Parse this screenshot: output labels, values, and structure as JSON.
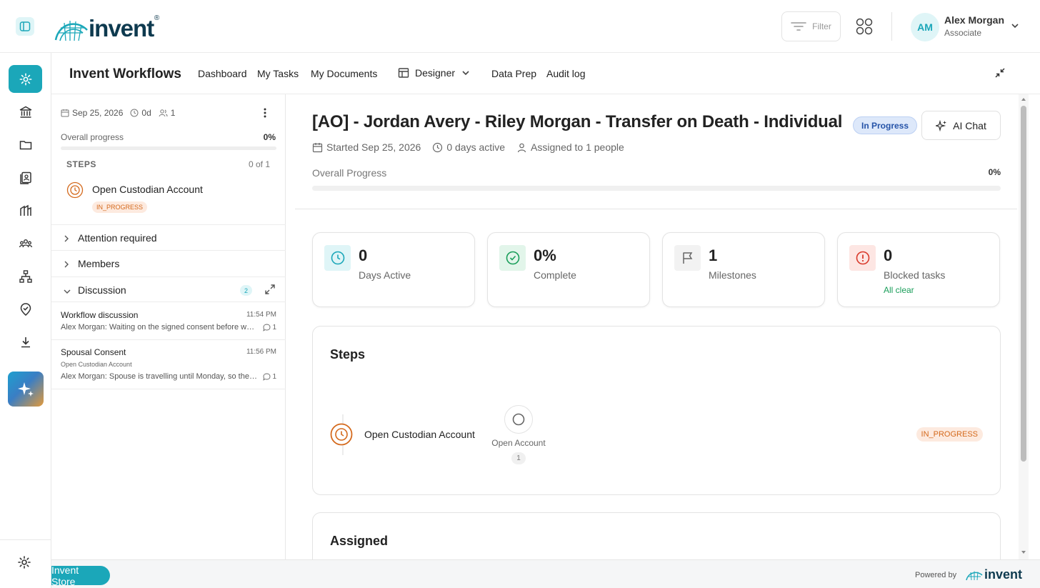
{
  "app": {
    "logo_text": "invent",
    "logo_reg": "®",
    "filter_label": "Filter",
    "user": {
      "initials": "AM",
      "name": "Alex Morgan",
      "role": "Associate"
    }
  },
  "rail": {
    "icons": [
      "gear-icon",
      "bank-icon",
      "folder-icon",
      "contacts-icon",
      "vault-icon",
      "team-icon",
      "org-chart-icon",
      "verified-icon",
      "download-icon"
    ],
    "ai_icon": "sparkle-icon",
    "bottom_icon": "settings-icon"
  },
  "workflow_bar": {
    "title": "Invent Workflows",
    "nav": [
      "Dashboard",
      "My Tasks",
      "My Documents"
    ],
    "designer": "Designer",
    "nav2": [
      "Data Prep",
      "Audit log"
    ]
  },
  "left_panel": {
    "date": "Sep 25, 2026",
    "days": "0d",
    "people": "1",
    "progress_label": "Overall progress",
    "progress_value": "0%",
    "progress_fraction": 0,
    "steps_heading": "STEPS",
    "steps_count": "0 of 1",
    "step": {
      "name": "Open Custodian Account",
      "status": "IN_PROGRESS"
    },
    "sections": {
      "attention": "Attention required",
      "members": "Members",
      "discussion": "Discussion",
      "discussion_count": "2"
    },
    "discussions": [
      {
        "title": "Workflow discussion",
        "time": "11:54 PM",
        "subtitle": "",
        "message": "Alex Morgan: Waiting on the signed consent before we ...",
        "replies": "1"
      },
      {
        "title": "Spousal Consent",
        "time": "11:56 PM",
        "subtitle": "Open Custodian Account",
        "message": "Alex Morgan: Spouse is travelling until Monday, so the ...",
        "replies": "1"
      }
    ]
  },
  "main": {
    "title": "[AO] - Jordan Avery - Riley Morgan - Transfer on Death - Individual",
    "status": "In Progress",
    "ai_chat": "AI Chat",
    "started": "Started Sep 25, 2026",
    "active": "0 days active",
    "assigned": "Assigned to 1 people",
    "progress_label": "Overall Progress",
    "progress_value": "0%",
    "progress_fraction": 0,
    "cards": [
      {
        "value": "0",
        "label": "Days Active",
        "sub": "",
        "icon": "clock-icon",
        "color": "#1ba7b9",
        "bg": "#dff5f7"
      },
      {
        "value": "0%",
        "label": "Complete",
        "sub": "",
        "icon": "check-circle-icon",
        "color": "#1a9e5a",
        "bg": "#e2f5ea"
      },
      {
        "value": "1",
        "label": "Milestones",
        "sub": "",
        "icon": "flag-icon",
        "color": "#666666",
        "bg": "#f2f2f2"
      },
      {
        "value": "0",
        "label": "Blocked tasks",
        "sub": "All clear",
        "icon": "alert-circle-icon",
        "color": "#d93a2b",
        "bg": "#fde6e3"
      }
    ],
    "steps_heading": "Steps",
    "step": {
      "name": "Open Custodian Account",
      "sub_label": "Open Account",
      "sub_count": "1",
      "status": "IN_PROGRESS"
    },
    "assigned_heading": "Assigned"
  },
  "footer": {
    "store": "Invent Store",
    "powered": "Powered by",
    "powered_logo": "invent"
  },
  "colors": {
    "accent": "#1ba7b9",
    "in_progress": "#d4691c"
  }
}
